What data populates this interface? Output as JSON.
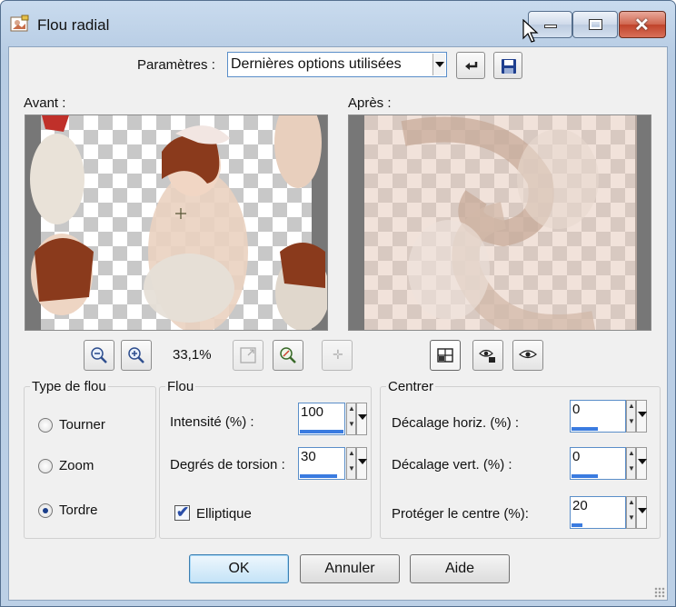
{
  "window": {
    "title": "Flou radial"
  },
  "params": {
    "label": "Paramètres :",
    "preset": "Dernières options utilisées"
  },
  "preview": {
    "before_label": "Avant :",
    "after_label": "Après :",
    "zoom": "33,1%"
  },
  "blur_type": {
    "title": "Type de flou",
    "options": [
      "Tourner",
      "Zoom",
      "Tordre"
    ],
    "selected": "Tordre"
  },
  "flou": {
    "title": "Flou",
    "intensity_label": "Intensité (%) :",
    "intensity": "100",
    "intensity_fill": 1.0,
    "torsion_label": "Degrés de torsion :",
    "torsion": "30",
    "torsion_fill": 0.86,
    "elliptic_label": "Elliptique",
    "elliptic_checked": true
  },
  "centrer": {
    "title": "Centrer",
    "horiz_label": "Décalage horiz. (%) :",
    "horiz": "0",
    "horiz_fill": 0.5,
    "vert_label": "Décalage vert. (%) :",
    "vert": "0",
    "vert_fill": 0.5,
    "protect_label": "Protéger le centre (%):",
    "protect": "20",
    "protect_fill": 0.2
  },
  "buttons": {
    "ok": "OK",
    "cancel": "Annuler",
    "help": "Aide"
  },
  "colors": {
    "accent": "#3a7be0",
    "titlebar": "#c1d5ec",
    "close": "#c84a32"
  }
}
